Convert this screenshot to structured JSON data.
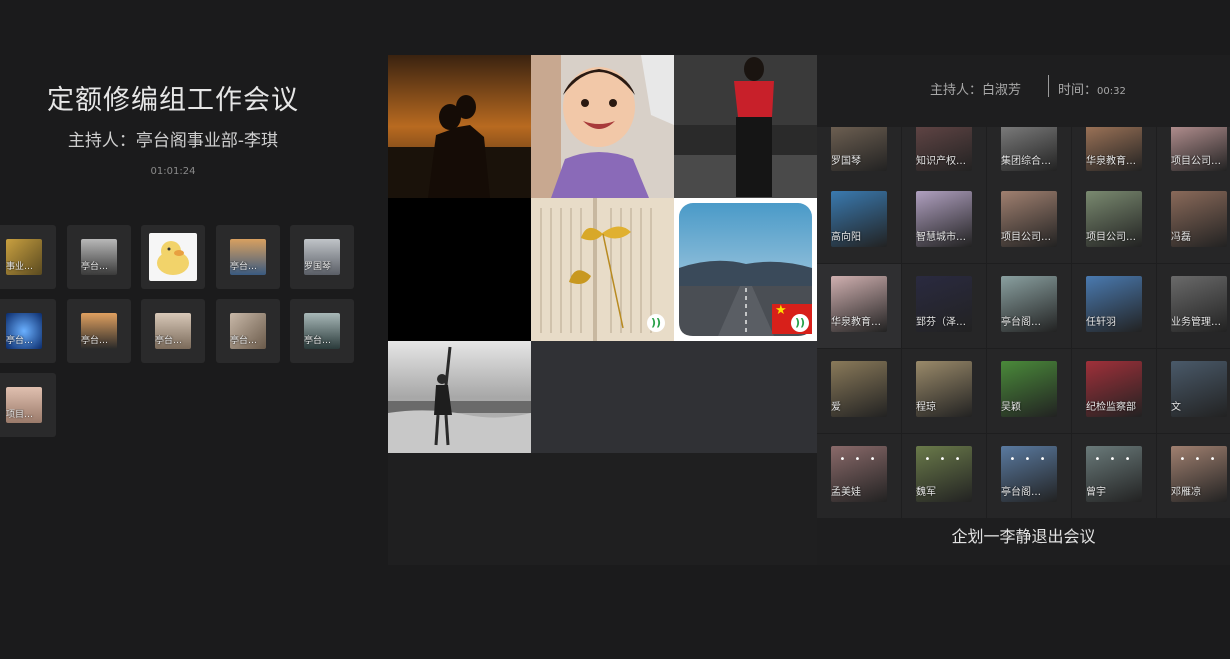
{
  "meeting": {
    "title": "定额修编组工作会议",
    "host_line": "主持人：亭台阁事业部-李琪",
    "duration": "01:01:24"
  },
  "left_participants": [
    {
      "name": "事业…",
      "color": "#7a6a3a"
    },
    {
      "name": "亭台…",
      "color": "#555a60"
    },
    {
      "name": "",
      "color": "#f2d36a"
    },
    {
      "name": "亭台…",
      "color": "#3a5a80"
    },
    {
      "name": "罗国琴",
      "color": "#7a7e88"
    },
    {
      "name": "亭台…",
      "color": "#2a5aa8"
    },
    {
      "name": "亭台…",
      "color": "#b07a4a"
    },
    {
      "name": "亭台…",
      "color": "#9a8a7a"
    },
    {
      "name": "亭台…",
      "color": "#8a7a6a"
    },
    {
      "name": "亭台…",
      "color": "#4a5a5a"
    },
    {
      "name": "项目…",
      "color": "#c9a28a"
    }
  ],
  "right_header": {
    "host": "主持人：白淑芳",
    "time_label": "时间：",
    "time_value": "00:32"
  },
  "right_participants": [
    {
      "name": "罗国琴",
      "color": "#7a6a5a"
    },
    {
      "name": "知识产权…",
      "color": "#6a4a4a"
    },
    {
      "name": "集团综合…",
      "color": "#8a8a8a"
    },
    {
      "name": "华泉教育…",
      "color": "#b08060"
    },
    {
      "name": "项目公司…",
      "color": "#c9a0a0"
    },
    {
      "name": "高向阳",
      "color": "#3a7ab0"
    },
    {
      "name": "智慧城市…",
      "color": "#b0a0c0"
    },
    {
      "name": "项目公司…",
      "color": "#a08070"
    },
    {
      "name": "项目公司…",
      "color": "#7a8a70"
    },
    {
      "name": "冯磊",
      "color": "#8a6a5a"
    },
    {
      "name": "华泉教育…",
      "color": "#d0b0b0"
    },
    {
      "name": "郅芬（泽…",
      "color": "#2a2a40"
    },
    {
      "name": "亭台阁…",
      "color": "#8aa0a0"
    },
    {
      "name": "任轩羽",
      "color": "#4a7ab0"
    },
    {
      "name": "业务管理…",
      "color": "#6a6a6a"
    },
    {
      "name": "爱",
      "color": "#8a7a5a"
    },
    {
      "name": "程琼",
      "color": "#9a8a6a"
    },
    {
      "name": "吴颖",
      "color": "#4a8a3a"
    },
    {
      "name": "纪检监察部",
      "color": "#a0303a"
    },
    {
      "name": "文",
      "color": "#4a5a6a"
    },
    {
      "name": "孟美娃",
      "color": "#8a6a6a"
    },
    {
      "name": "魏军",
      "color": "#6a7a4a"
    },
    {
      "name": "亭台阁…",
      "color": "#5a7aa0"
    },
    {
      "name": "曾宇",
      "color": "#6a7a7a"
    },
    {
      "name": "邓雁凉",
      "color": "#a08070"
    }
  ],
  "right_dots": "• • •",
  "toast": "企划一李静退出会议",
  "video_feeds": [
    {
      "label": "sunset-couple"
    },
    {
      "label": "smiling-child"
    },
    {
      "label": "red-top-woman"
    },
    {
      "label": "black-screen"
    },
    {
      "label": "ginkgo-book"
    },
    {
      "label": "road-sky"
    },
    {
      "label": "beach-person"
    },
    {
      "label": "empty"
    },
    {
      "label": "empty"
    }
  ],
  "audio_symbol": "))",
  "flag_star": "★"
}
